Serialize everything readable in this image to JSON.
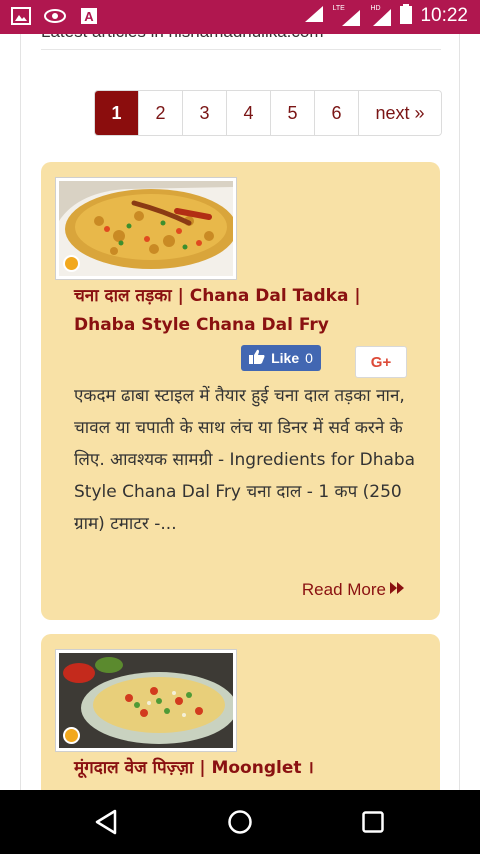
{
  "statusbar": {
    "left_icons": [
      "image-icon",
      "eye-icon",
      "font-a-icon"
    ],
    "network_label": "LTE",
    "hd_label": "HD",
    "time": "10:22"
  },
  "previous": {
    "text": "Latest articles in nishamadhulika.com"
  },
  "pagination": {
    "pages": [
      "1",
      "2",
      "3",
      "4",
      "5",
      "6"
    ],
    "active": "1",
    "next_label": "next »"
  },
  "cards": [
    {
      "title": "चना दाल तड़का | Chana Dal Tadka | Dhaba Style Chana Dal Fry",
      "like_label": "Like",
      "like_count": "0",
      "gplus_label": "G+",
      "excerpt": "एकदम ढाबा स्टाइल में तैयार हुई चना दाल तड़का नान, चावल या चपाती के साथ लंच या डिनर में सर्व करने के लिए. आवश्यक सामग्री - Ingredients for Dhaba Style Chana Dal Fry चना दाल - 1 कप (250 ग्राम) टमाटर -...",
      "read_more": "Read More"
    },
    {
      "title": "मूंगदाल वेज पिज़्ज़ा | Moonglet ।"
    }
  ],
  "colors": {
    "statusbar": "#b0174f",
    "accent": "#8a1111",
    "card_bg": "#f8e1a6",
    "active_page": "#8b0d0d"
  },
  "navbar": {
    "icons": [
      "back-icon",
      "home-icon",
      "recents-icon"
    ]
  }
}
